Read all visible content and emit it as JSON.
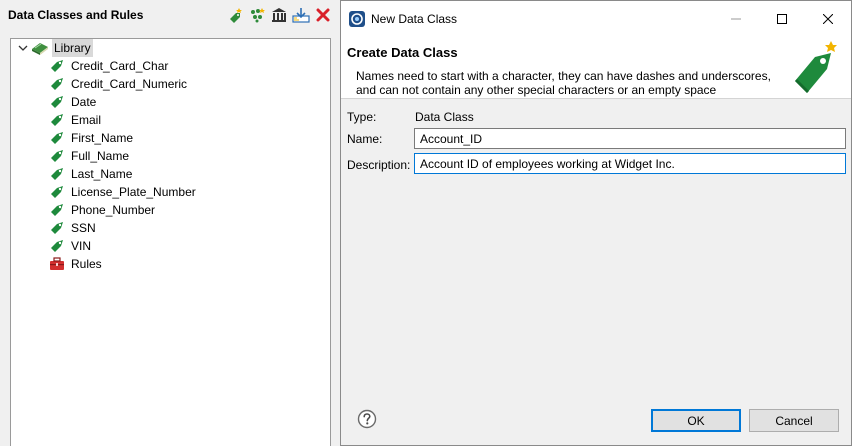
{
  "left_panel": {
    "title": "Data Classes and Rules",
    "toolbar": [
      {
        "name": "new-data-class-icon",
        "color": "#2e8b3a"
      },
      {
        "name": "new-rule-icon",
        "color": "#2e8b3a"
      },
      {
        "name": "library-icon",
        "color": "#333333"
      },
      {
        "name": "import-icon",
        "color": "#2d6fb5"
      },
      {
        "name": "delete-icon",
        "color": "#d9202a"
      }
    ],
    "tree": {
      "root": {
        "label": "Library",
        "icon": "library-book-icon",
        "expanded": true
      },
      "children": [
        {
          "label": "Credit_Card_Char",
          "icon": "tag-icon"
        },
        {
          "label": "Credit_Card_Numeric",
          "icon": "tag-icon"
        },
        {
          "label": "Date",
          "icon": "tag-icon"
        },
        {
          "label": "Email",
          "icon": "tag-icon"
        },
        {
          "label": "First_Name",
          "icon": "tag-icon"
        },
        {
          "label": "Full_Name",
          "icon": "tag-icon"
        },
        {
          "label": "Last_Name",
          "icon": "tag-icon"
        },
        {
          "label": "License_Plate_Number",
          "icon": "tag-icon"
        },
        {
          "label": "Phone_Number",
          "icon": "tag-icon"
        },
        {
          "label": "SSN",
          "icon": "tag-icon"
        },
        {
          "label": "VIN",
          "icon": "tag-icon"
        },
        {
          "label": "Rules",
          "icon": "toolbox-icon"
        }
      ]
    }
  },
  "dialog": {
    "window_title": "New Data Class",
    "banner": {
      "title": "Create Data Class",
      "message": "Names need to start with a character, they can have dashes and underscores, and can not contain any other special characters or an empty space"
    },
    "form": {
      "type_label": "Type:",
      "type_value": "Data Class",
      "name_label": "Name:",
      "name_value": "Account_ID",
      "description_label": "Description:",
      "description_value": "Account ID of employees working at Widget Inc."
    },
    "buttons": {
      "ok": "OK",
      "cancel": "Cancel"
    }
  },
  "colors": {
    "tag_green": "#1e8a3c",
    "accent_blue": "#0078d7",
    "rules_red": "#d32f2f"
  }
}
